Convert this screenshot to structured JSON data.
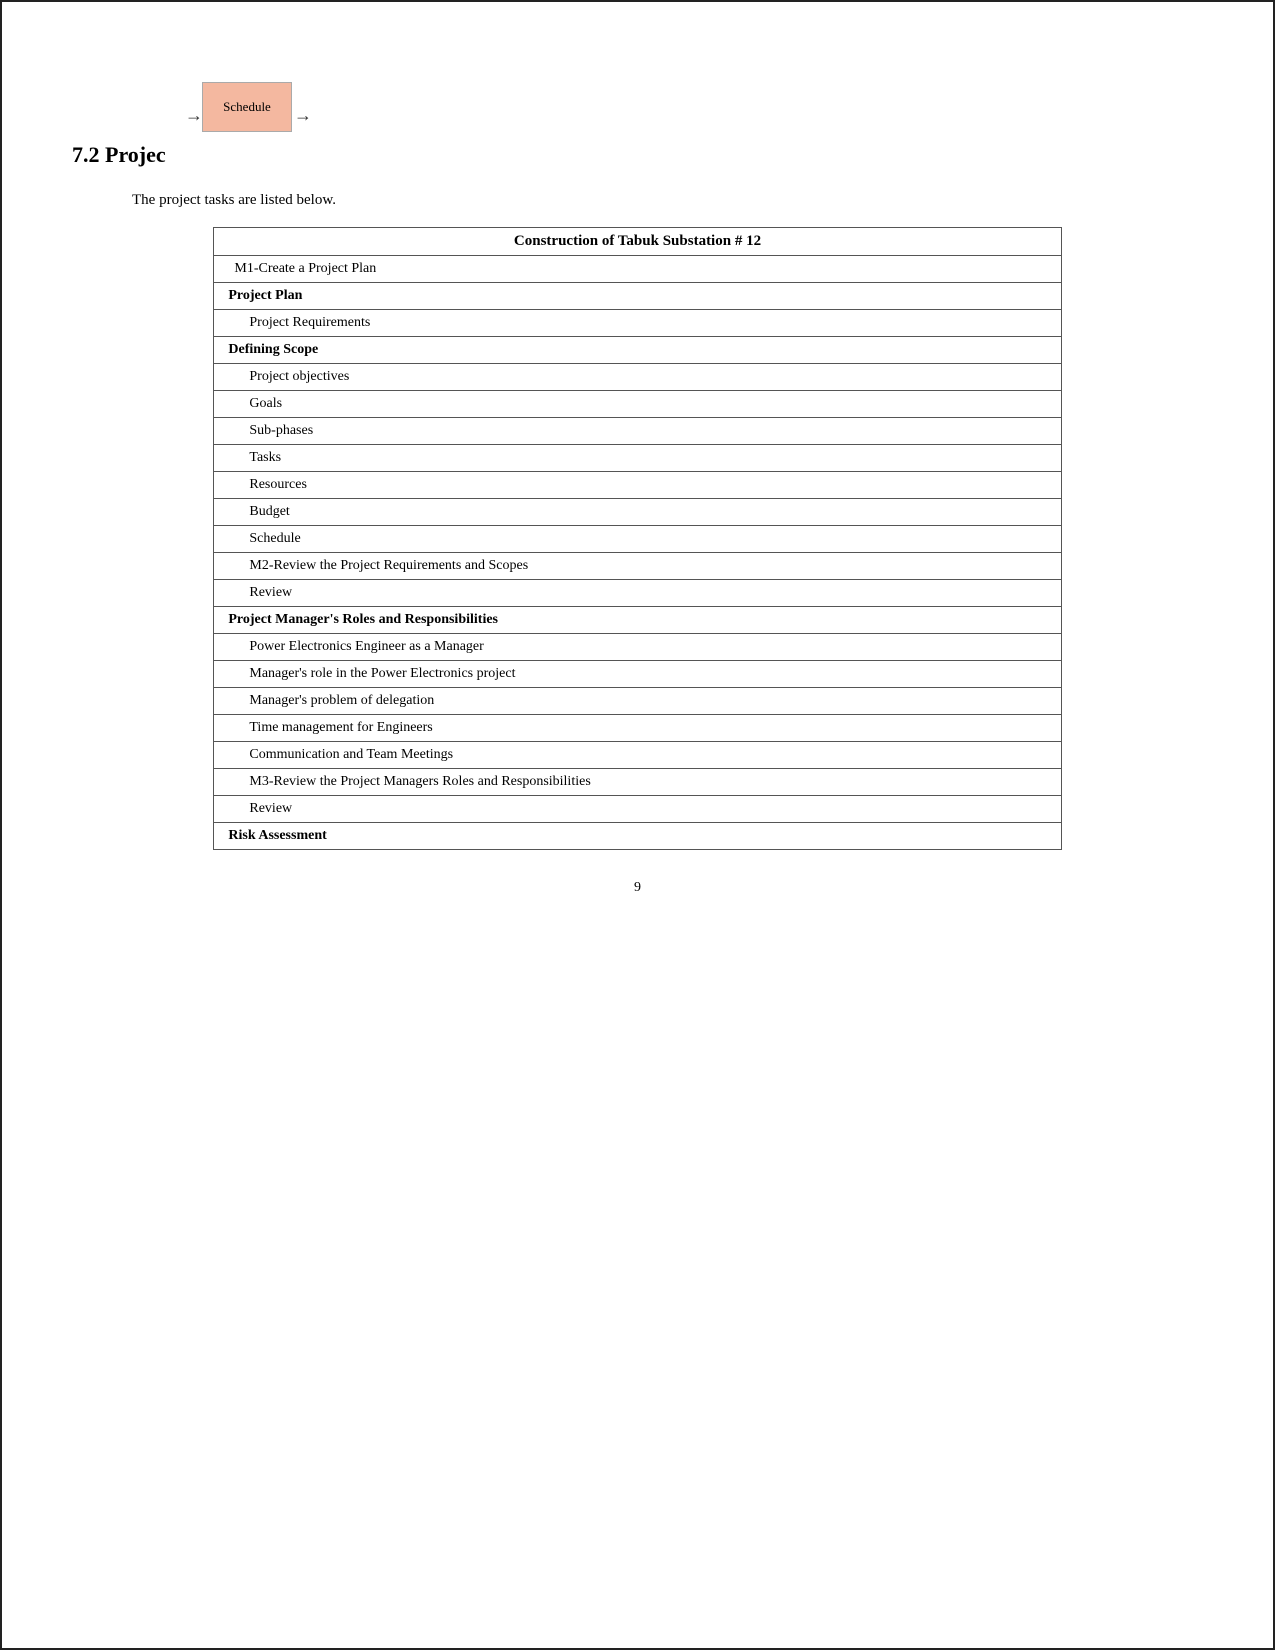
{
  "header": {
    "section": "7.2  Projec",
    "intro": "The project tasks are listed below."
  },
  "diagram": {
    "schedule_label": "Schedule",
    "arrow_left": "→",
    "arrow_right": "→"
  },
  "table": {
    "rows": [
      {
        "level": "level0",
        "text": "Construction of Tabuk Substation # 12"
      },
      {
        "level": "level1",
        "text": "M1-Create a Project Plan"
      },
      {
        "level": "level1b",
        "text": "Project Plan"
      },
      {
        "level": "level3",
        "text": "Project Requirements"
      },
      {
        "level": "level2",
        "text": "Defining Scope"
      },
      {
        "level": "level3",
        "text": "Project objectives"
      },
      {
        "level": "level3",
        "text": "Goals"
      },
      {
        "level": "level3",
        "text": "Sub-phases"
      },
      {
        "level": "level3",
        "text": "Tasks"
      },
      {
        "level": "level3",
        "text": "Resources"
      },
      {
        "level": "level3",
        "text": "Budget"
      },
      {
        "level": "level3",
        "text": "Schedule"
      },
      {
        "level": "level3",
        "text": "M2-Review the Project Requirements and Scopes"
      },
      {
        "level": "level3",
        "text": "Review"
      },
      {
        "level": "level2",
        "text": "Project Manager's Roles and Responsibilities"
      },
      {
        "level": "level3",
        "text": "Power Electronics Engineer as a Manager"
      },
      {
        "level": "level3",
        "text": "Manager's role in the Power Electronics project"
      },
      {
        "level": "level3",
        "text": "Manager's problem of delegation"
      },
      {
        "level": "level3",
        "text": "Time management for Engineers"
      },
      {
        "level": "level3",
        "text": "Communication and Team Meetings"
      },
      {
        "level": "level3",
        "text": "M3-Review the Project Managers Roles and Responsibilities"
      },
      {
        "level": "level3",
        "text": "Review"
      },
      {
        "level": "level2",
        "text": "Risk Assessment"
      }
    ]
  },
  "page_number": "9"
}
